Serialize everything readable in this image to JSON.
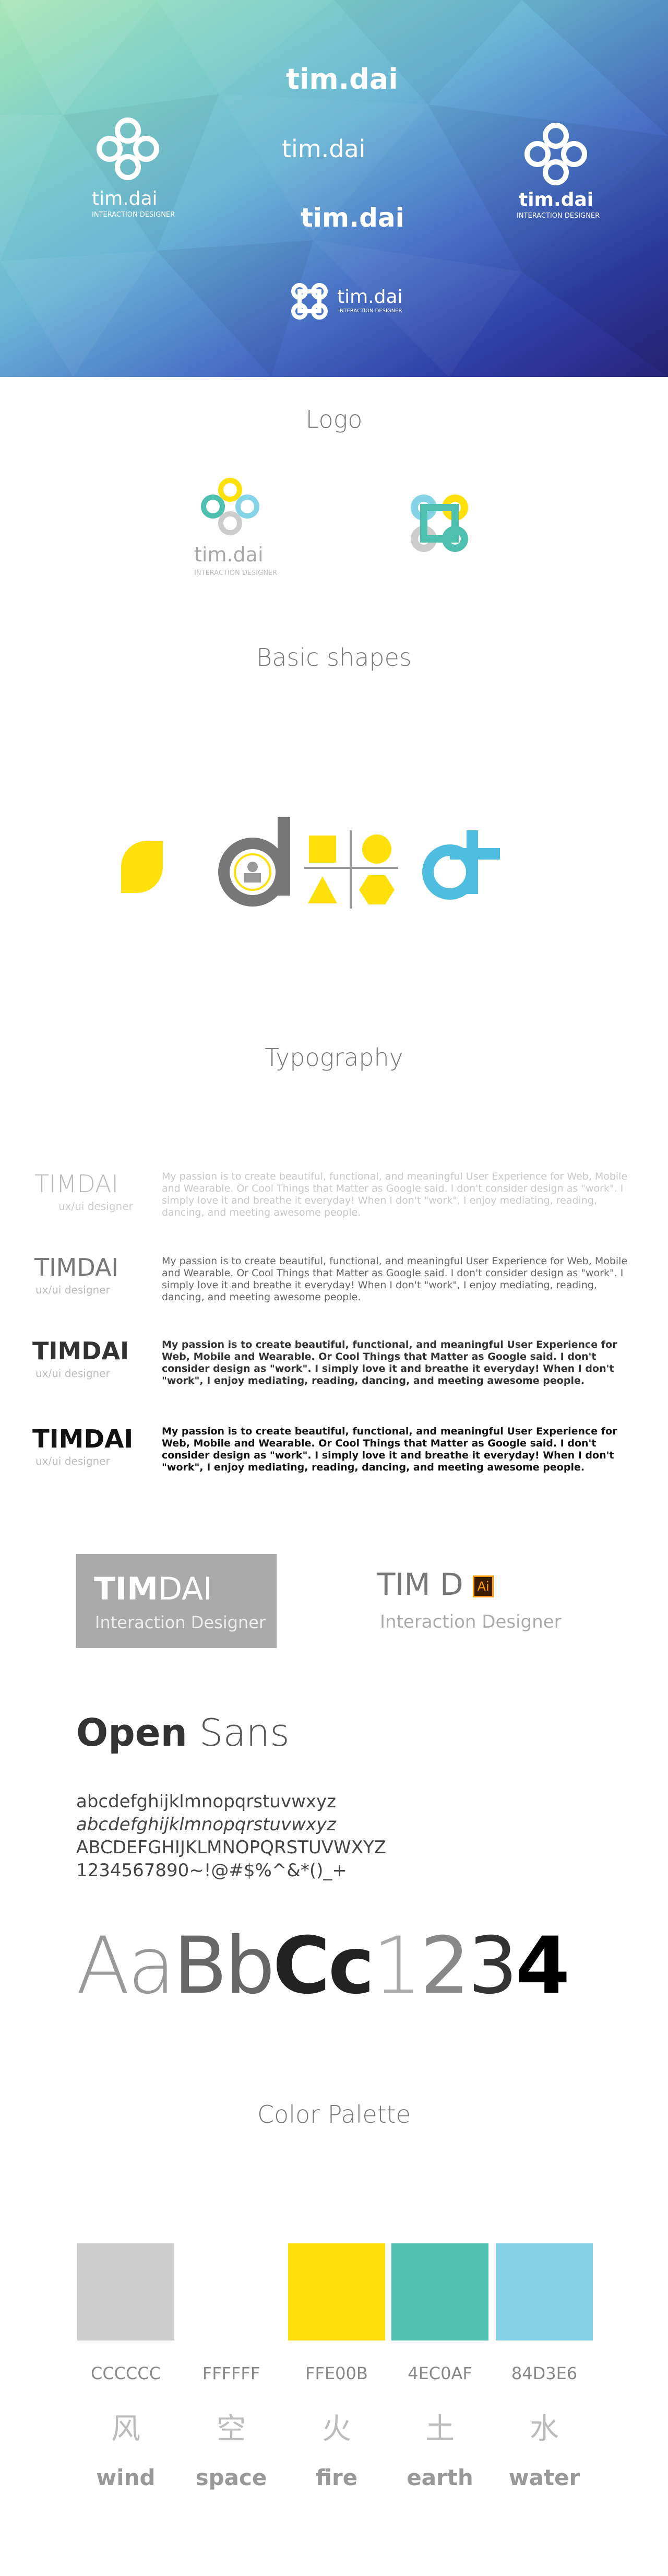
{
  "hero": {
    "brand_text": "tim.dai",
    "tagline": "INTERACTION DESIGNER",
    "small_tagline": "INTERACTION DESIGNER"
  },
  "sections": {
    "logo": "Logo",
    "shapes": "Basic shapes",
    "typography": "Typography",
    "palette": "Color Palette"
  },
  "logo_section": {
    "wordmark": "tim.dai",
    "tagline": "INTERACTION DESIGNER"
  },
  "typography": {
    "samples": [
      {
        "name": "TIMDAI",
        "sub": "ux/ui designer",
        "text": "My passion is to create beautiful, functional, and meaningful User Experience for Web, Mobile and Wearable. Or Cool Things that Matter as Google said. I don't consider design as \"work\". I simply love it and breathe it everyday!  When I don't \"work\", I enjoy mediating, reading, dancing, and meeting awesome people."
      },
      {
        "name": "TIMDAI",
        "sub": "ux/ui designer",
        "text": "My passion is to create beautiful, functional, and meaningful User Experience for Web, Mobile and Wearable. Or Cool Things that Matter as Google said. I don't consider design as \"work\". I simply love it and breathe it everyday!  When I don't \"work\", I enjoy mediating, reading, dancing, and meeting awesome people."
      },
      {
        "name": "TIMDAI",
        "sub": "ux/ui designer",
        "text": "My passion is to create beautiful, functional, and meaningful User Experience for Web, Mobile and Wearable. Or Cool Things that Matter as Google said. I don't consider design as \"work\". I simply love it and breathe it everyday!  When I don't \"work\", I enjoy mediating, reading, dancing, and meeting awesome people."
      },
      {
        "name": "TIMDAI",
        "sub": "ux/ui designer",
        "text": "My passion is to create beautiful, functional, and meaningful User Experience for Web, Mobile and Wearable. Or Cool Things that Matter as Google said. I don't consider design as \"work\". I simply love it and breathe it everyday!  When I don't \"work\", I enjoy mediating, reading, dancing, and meeting awesome people."
      }
    ],
    "badge_left_bold": "TIM",
    "badge_left_light": "DAI",
    "badge_left_sub": "Interaction Designer",
    "badge_right_name": "TIM D",
    "badge_right_ai": "Ai",
    "badge_right_sub": "Interaction Designer",
    "font_bold": "Open",
    "font_light": "Sans",
    "lower": "abcdefghijklmnopqrstuvwxyz",
    "lower_italic": "abcdefghijklmnopqrstuvwxyz",
    "upper": "ABCDEFGHIJKLMNOPQRSTUVWXYZ",
    "digits": "1234567890~!@#$%^&*()_+",
    "weights": [
      "Aa",
      "Bb",
      "Cc",
      "1",
      "2",
      "3",
      "4"
    ]
  },
  "palette": {
    "colors": [
      {
        "hex": "CCCCCC",
        "color": "#CCCCCC",
        "glyph": "风",
        "element": "wind"
      },
      {
        "hex": "FFFFFF",
        "color": "#FFFFFF",
        "glyph": "空",
        "element": "space"
      },
      {
        "hex": "FFE00B",
        "color": "#FFE00B",
        "glyph": "火",
        "element": "fire"
      },
      {
        "hex": "4EC0AF",
        "color": "#4EC0AF",
        "glyph": "土",
        "element": "earth"
      },
      {
        "hex": "84D3E6",
        "color": "#84D3E6",
        "glyph": "水",
        "element": "water"
      }
    ]
  }
}
